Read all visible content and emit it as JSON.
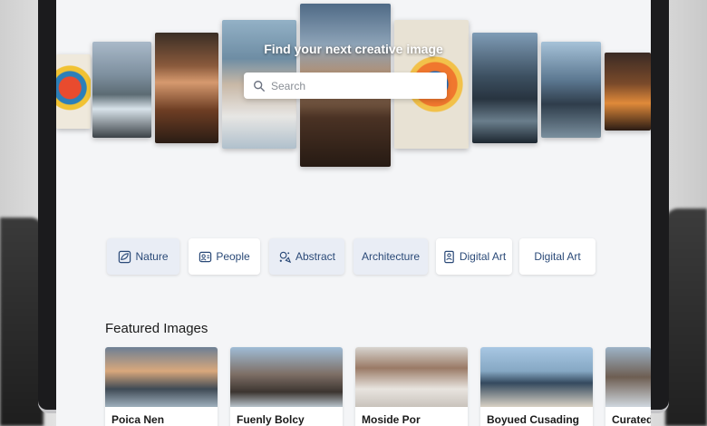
{
  "hero": {
    "title": "Find your next creative image"
  },
  "search": {
    "placeholder": "Search",
    "value": ""
  },
  "categories": [
    {
      "label": "Nature",
      "icon": "leaf-icon"
    },
    {
      "label": "People",
      "icon": "people-icon"
    },
    {
      "label": "Abstract",
      "icon": "abstract-icon"
    },
    {
      "label": "Architecture",
      "icon": ""
    },
    {
      "label": "Digital Art",
      "icon": "tablet-icon"
    },
    {
      "label": "Digital Art",
      "icon": ""
    }
  ],
  "featured": {
    "title": "Featured Images",
    "cards": [
      {
        "caption": "Poica Nen"
      },
      {
        "caption": "Fuenly Bolcy"
      },
      {
        "caption": "Moside Por"
      },
      {
        "caption": "Boyued Cusading"
      },
      {
        "caption": "Curated"
      }
    ]
  },
  "colors": {
    "accent": "#2b4a78",
    "chip_tint": "#e9edf5",
    "screen_bg": "#f4f5f7"
  }
}
